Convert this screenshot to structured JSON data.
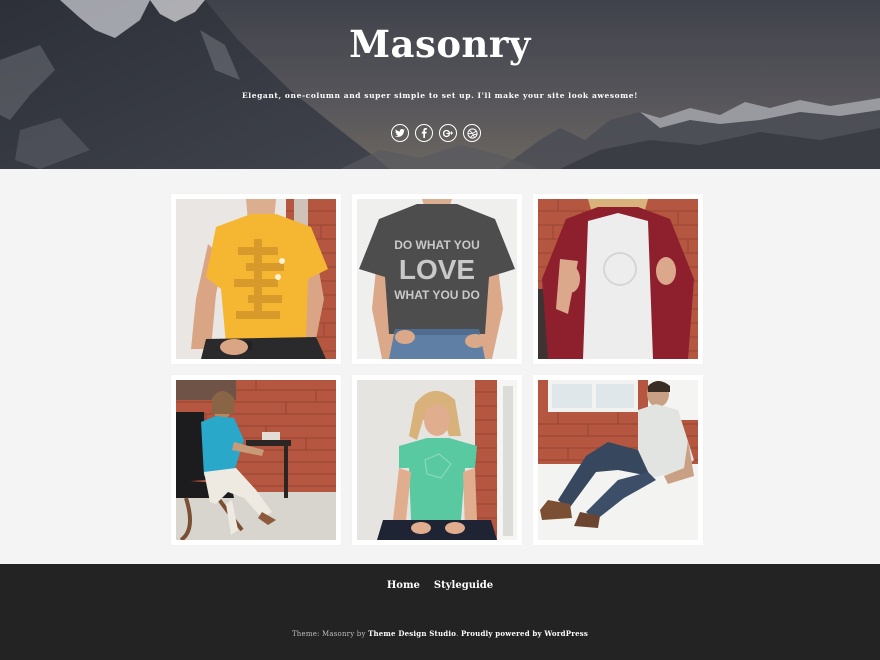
{
  "header": {
    "title": "Masonry",
    "tagline": "Elegant, one-column and super simple to set up. I'll make your site look awesome!",
    "social": [
      "twitter-icon",
      "facebook-icon",
      "google-plus-icon",
      "dribbble-icon"
    ]
  },
  "gallery": {
    "items": [
      {
        "shirt": "#f5b731",
        "subject": "man in yellow t-shirt"
      },
      {
        "shirt": "#4d4d4d",
        "subject": "person in grey DO WHAT YOU LOVE t-shirt",
        "print": [
          "DO WHAT YOU",
          "LOVE",
          "WHAT YOU DO"
        ]
      },
      {
        "shirt": "#ededed",
        "subject": "woman in white tee and red cardigan"
      },
      {
        "shirt": "#2aa8c9",
        "subject": "woman in blue tee sitting on chair"
      },
      {
        "shirt": "#58c9a1",
        "subject": "woman in mint tee sitting"
      },
      {
        "shirt": "#e2e4e1",
        "subject": "man in grey tee sitting on floor"
      }
    ]
  },
  "footer": {
    "nav": [
      "Home",
      "Styleguide"
    ],
    "credits_prefix": "Theme: Masonry by ",
    "credits_author": "Theme Design Studio",
    "credits_sep": ". ",
    "credits_powered": "Proudly powered by WordPress"
  },
  "colors": {
    "footer_bg": "#232323",
    "page_bg": "#f4f4f5",
    "brick": "#b5533c"
  }
}
